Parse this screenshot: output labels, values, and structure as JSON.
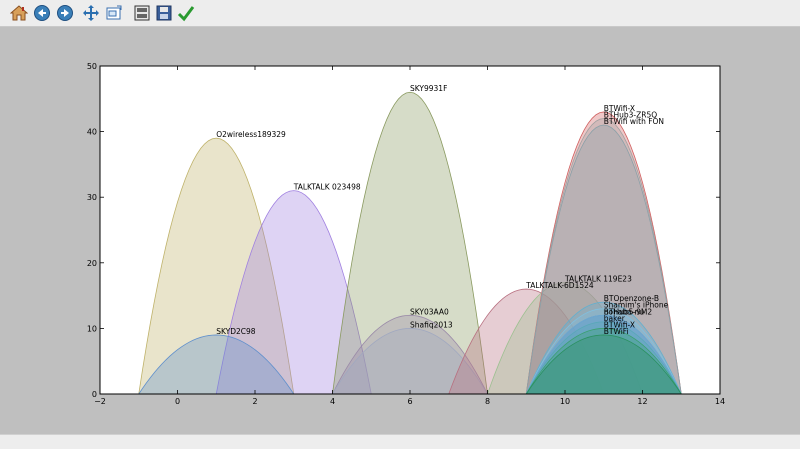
{
  "toolbar": {
    "buttons": [
      {
        "name": "home-button",
        "icon": "home-icon"
      },
      {
        "name": "back-button",
        "icon": "back-arrow-icon"
      },
      {
        "name": "forward-button",
        "icon": "forward-arrow-icon"
      },
      {
        "name": "pan-button",
        "icon": "move-cross-icon"
      },
      {
        "name": "zoom-button",
        "icon": "zoom-rect-icon"
      },
      {
        "name": "subplots-button",
        "icon": "subplots-config-icon"
      },
      {
        "name": "save-button",
        "icon": "floppy-disk-icon"
      },
      {
        "name": "edit-axis-button",
        "icon": "checkmark-icon"
      }
    ]
  },
  "chart_data": {
    "type": "area",
    "title": "",
    "xlabel": "",
    "ylabel": "",
    "xlim": [
      -2,
      14
    ],
    "ylim": [
      0,
      50
    ],
    "xticks": [
      -2,
      0,
      2,
      4,
      6,
      8,
      10,
      12,
      14
    ],
    "yticks": [
      0,
      10,
      20,
      30,
      40,
      50
    ],
    "grid": false,
    "series": [
      {
        "name": "O2wireless189329",
        "x_start": -1,
        "x_end": 3,
        "peak": 39,
        "color": "#bfb26a"
      },
      {
        "name": "TALKTALK 023498",
        "x_start": 1,
        "x_end": 5,
        "peak": 31,
        "color": "#a080e0"
      },
      {
        "name": "SKYD2C98",
        "x_start": -1,
        "x_end": 3,
        "peak": 9,
        "color": "#5f8fcc"
      },
      {
        "name": "SKY9931F",
        "x_start": 4,
        "x_end": 8,
        "peak": 46,
        "color": "#8a9a60"
      },
      {
        "name": "SKY03AA0",
        "x_start": 4,
        "x_end": 8,
        "peak": 12,
        "color": "#9a8aa8"
      },
      {
        "name": "Shafiq2013",
        "x_start": 4,
        "x_end": 8,
        "peak": 10,
        "color": "#a0a8c0"
      },
      {
        "name": "TALKTALK-6D1524",
        "x_start": 7,
        "x_end": 11,
        "peak": 16,
        "color": "#b87080"
      },
      {
        "name": "TALKTALK 119E23",
        "x_start": 8,
        "x_end": 12,
        "peak": 17,
        "color": "#9cc090"
      },
      {
        "name": "BTWifi-X",
        "x_start": 9,
        "x_end": 13,
        "peak": 43,
        "color": "#d06060"
      },
      {
        "name": "BTHub3-ZR5Q",
        "x_start": 9,
        "x_end": 13,
        "peak": 42,
        "color": "#a0a0a0"
      },
      {
        "name": "BTWifi with FON",
        "x_start": 9,
        "x_end": 13,
        "peak": 41,
        "color": "#8aa0a8"
      },
      {
        "name": "BTOpenzone-B",
        "x_start": 9,
        "x_end": 13,
        "peak": 14,
        "color": "#60b0d0"
      },
      {
        "name": "Shamim's iPhone",
        "x_start": 9,
        "x_end": 13,
        "peak": 13,
        "color": "#80c0e0"
      },
      {
        "name": "BTHub5-9M2",
        "x_start": 9,
        "x_end": 13,
        "peak": 12,
        "color": "#4a90c8"
      },
      {
        "name": "nohaba-nu",
        "x_start": 9,
        "x_end": 13,
        "peak": 12,
        "color": "#70a8d0"
      },
      {
        "name": "baker",
        "x_start": 9,
        "x_end": 13,
        "peak": 11,
        "color": "#58a8b8"
      },
      {
        "name": "BTWifi-X",
        "x_start": 9,
        "x_end": 13,
        "peak": 10,
        "color": "#3aa070"
      },
      {
        "name": "BTWiFi",
        "x_start": 9,
        "x_end": 13,
        "peak": 9,
        "color": "#2a9060"
      }
    ]
  }
}
